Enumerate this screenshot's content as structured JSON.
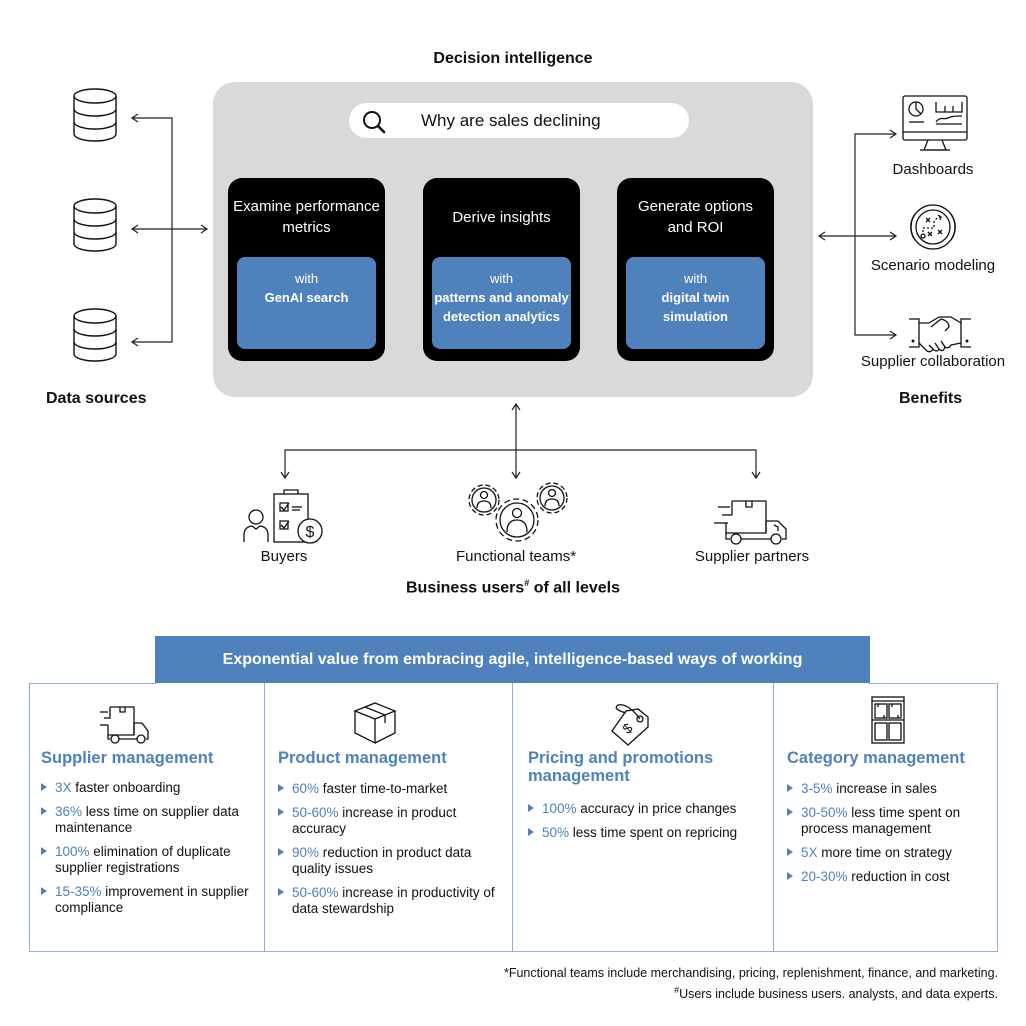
{
  "decision_intelligence": {
    "title": "Decision intelligence",
    "search": {
      "icon": "search-icon",
      "query": "Why are sales declining"
    },
    "steps": [
      {
        "title": "Examine performance metrics",
        "with": "with",
        "technology": "GenAI search"
      },
      {
        "title": "Derive insights",
        "with": "with",
        "technology": "patterns and anomaly detection analytics"
      },
      {
        "title": "Generate options and ROI",
        "with": "with",
        "technology": "digital twin simulation"
      }
    ]
  },
  "data_sources": {
    "label": "Data sources",
    "icons": [
      "database-icon",
      "database-icon",
      "database-icon"
    ]
  },
  "benefits": {
    "label": "Benefits",
    "items": [
      {
        "label": "Dashboards",
        "icon": "dashboard-monitor-icon"
      },
      {
        "label": "Scenario modeling",
        "icon": "scenario-playbook-icon"
      },
      {
        "label": "Supplier collaboration",
        "icon": "handshake-icon"
      }
    ]
  },
  "business_users": {
    "label_main": "Business users",
    "label_sup": "#",
    "label_rest": " of all levels",
    "items": [
      {
        "label": "Buyers",
        "icon": "buyer-checklist-dollar-icon"
      },
      {
        "label": "Functional teams*",
        "icon": "team-gears-icon"
      },
      {
        "label": "Supplier partners",
        "icon": "delivery-truck-icon"
      }
    ]
  },
  "value": {
    "banner": "Exponential value from embracing agile, intelligence-based ways of working",
    "colors": {
      "accent": "#4f81bd",
      "border": "#8eb0d8"
    },
    "columns": [
      {
        "title": "Supplier management",
        "icon": "delivery-truck-icon",
        "items": [
          {
            "metric": "3X",
            "text": " faster onboarding"
          },
          {
            "metric": "36%",
            "text": " less time on supplier data maintenance"
          },
          {
            "metric": "100%",
            "text": " elimination of duplicate supplier registrations"
          },
          {
            "metric": "15-35%",
            "text": " improvement in supplier compliance"
          }
        ]
      },
      {
        "title": "Product management",
        "icon": "box-icon",
        "items": [
          {
            "metric": "60%",
            "text": " faster time-to-market"
          },
          {
            "metric": "50-60%",
            "text": " increase in product accuracy"
          },
          {
            "metric": "90%",
            "text": " reduction in product data quality issues"
          },
          {
            "metric": "50-60%",
            "text": " increase in productivity of data stewardship"
          }
        ]
      },
      {
        "title": "Pricing and promotions management",
        "icon": "price-tag-icon",
        "items": [
          {
            "metric": "100%",
            "text": " accuracy in price changes"
          },
          {
            "metric": "50%",
            "text": " less time spent on repricing"
          }
        ]
      },
      {
        "title": "Category management",
        "icon": "shelf-category-icon",
        "items": [
          {
            "metric": "3-5%",
            "text": " increase in sales"
          },
          {
            "metric": "30-50%",
            "text": " less time spent on process management"
          },
          {
            "metric": "5X",
            "text": " more time on strategy"
          },
          {
            "metric": "20-30%",
            "text": " reduction in cost"
          }
        ]
      }
    ]
  },
  "footnotes": {
    "functional_teams": "*Functional teams include merchandising, pricing, replenishment, finance, and marketing.",
    "users_mark": "#",
    "users": "Users include business users. analysts, and data experts."
  }
}
